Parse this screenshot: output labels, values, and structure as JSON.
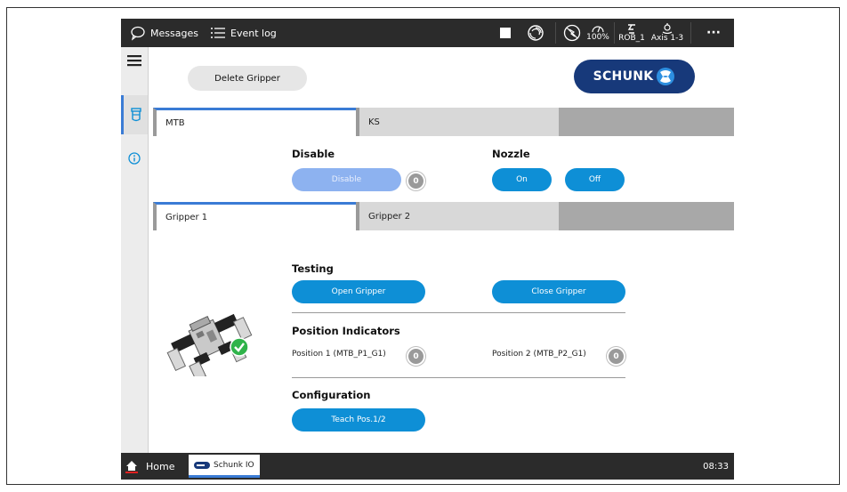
{
  "topbar": {
    "messages_label": "Messages",
    "event_log_label": "Event log",
    "speed": "100%",
    "robot": "ROB_1",
    "axis": "Axis 1-3",
    "more": "···"
  },
  "toolbar": {
    "delete_label": "Delete Gripper",
    "logo_text": "SCHUNK"
  },
  "tabs_top": {
    "items": [
      {
        "label": "MTB",
        "active": true
      },
      {
        "label": "KS",
        "active": false
      }
    ]
  },
  "disable": {
    "title": "Disable",
    "button": "Disable",
    "count": "0"
  },
  "nozzle": {
    "title": "Nozzle",
    "on": "On",
    "off": "Off"
  },
  "tabs_gripper": {
    "items": [
      {
        "label": "Gripper 1",
        "active": true
      },
      {
        "label": "Gripper 2",
        "active": false
      }
    ]
  },
  "testing": {
    "title": "Testing",
    "open": "Open Gripper",
    "close": "Close Gripper"
  },
  "positions": {
    "title": "Position Indicators",
    "p1_label": "Position 1 (MTB_P1_G1)",
    "p1_value": "0",
    "p2_label": "Position 2 (MTB_P2_G1)",
    "p2_value": "0"
  },
  "config": {
    "title": "Configuration",
    "teach": "Teach Pos.1/2"
  },
  "bottombar": {
    "home": "Home",
    "app": "Schunk IO",
    "time": "08:33"
  },
  "colors": {
    "accent": "#0e8fd6",
    "disabled": "#8db2f0",
    "brand": "#17397a",
    "tab_active": "#3a7bd5",
    "success": "#2fb34a"
  }
}
